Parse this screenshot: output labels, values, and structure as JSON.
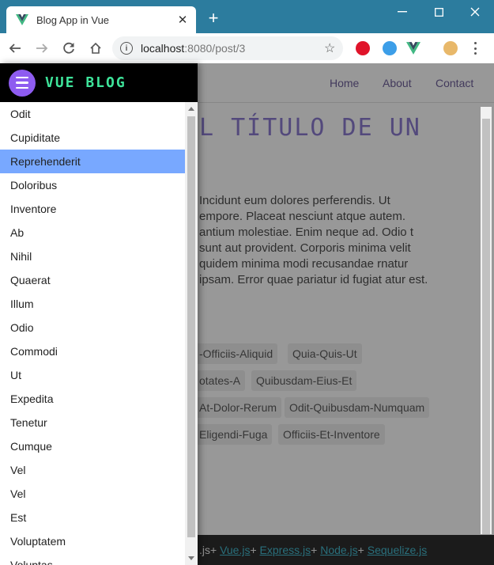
{
  "browser": {
    "tab_title": "Blog App in Vue",
    "tab_close": "✕",
    "new_tab": "+",
    "url_host": "localhost",
    "url_path": ":8080/post/3",
    "minimize": "—",
    "maximize": "☐",
    "close": "✕"
  },
  "site_nav": {
    "links": [
      "Home",
      "About",
      "Contact"
    ]
  },
  "post": {
    "title": "L TÍTULO DE UN",
    "body": "Incidunt eum dolores perferendis. Ut empore. Placeat nesciunt atque autem. antium molestiae. Enim neque ad. Odio t sunt aut provident. Corporis minima velit quidem minima modi recusandae rnatur ipsam. Error quae pariatur id fugiat atur est.",
    "tags": [
      "-Officiis-Aliquid",
      "Quia-Quis-Ut",
      "otates-A",
      "Quibusdam-Eius-Et",
      "At-Dolor-Rerum",
      "Odit-Quibusdam-Numquam",
      "Eligendi-Fuga",
      "Officiis-Et-Inventore"
    ]
  },
  "footer": {
    "prefix": ".js",
    "links": [
      "Vue.js",
      "Express.js",
      "Node.js",
      "Sequelize.js"
    ],
    "separator": "+ "
  },
  "drawer": {
    "brand": "VUE BLOG",
    "items": [
      "Odit",
      "Cupiditate",
      "Reprehenderit",
      "Doloribus",
      "Inventore",
      "Ab",
      "Nihil",
      "Quaerat",
      "Illum",
      "Odio",
      "Commodi",
      "Ut",
      "Expedita",
      "Tenetur",
      "Cumque",
      "Vel",
      "Vel",
      "Est",
      "Voluptatem",
      "Voluptas"
    ],
    "selected_index": 2
  },
  "colors": {
    "accent": "#7b69c9",
    "brand_green": "#3ee39a",
    "burger_purple": "#8e5cf0",
    "selected_item": "#78a8ff",
    "titlebar": "#2c7c9e"
  }
}
